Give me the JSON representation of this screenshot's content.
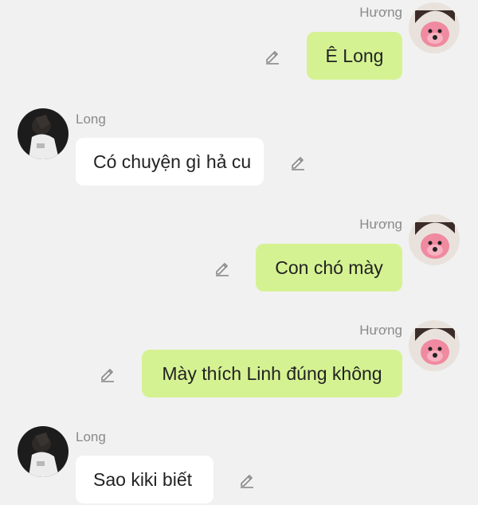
{
  "messages": [
    {
      "sender": "Hương",
      "text": "Ê Long",
      "direction": "outgoing"
    },
    {
      "sender": "Long",
      "text": "Có chuyện gì hả cu",
      "direction": "incoming"
    },
    {
      "sender": "Hương",
      "text": "Con chó mày",
      "direction": "outgoing"
    },
    {
      "sender": "Hương",
      "text": "Mày thích Linh đúng không",
      "direction": "outgoing"
    },
    {
      "sender": "Long",
      "text": "Sao kiki biết",
      "direction": "incoming"
    }
  ],
  "colors": {
    "background": "#f1f1f1",
    "outgoing_bubble": "#d5f292",
    "incoming_bubble": "#ffffff",
    "sender_name": "#8a8a8a"
  },
  "icons": {
    "edit": "pencil-edit-icon"
  }
}
